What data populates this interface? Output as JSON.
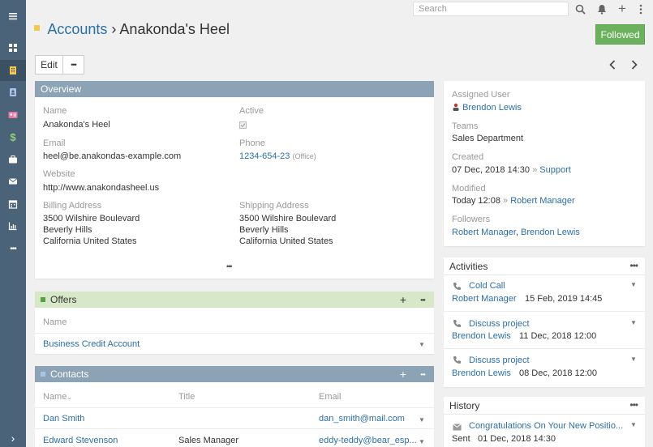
{
  "nav": {
    "items": [
      {
        "name": "menu-toggle",
        "icon": "hamburger-icon"
      },
      {
        "name": "home",
        "icon": "dashboard-icon"
      },
      {
        "name": "accounts",
        "icon": "building-icon",
        "active": true
      },
      {
        "name": "contacts",
        "icon": "contact-book-icon"
      },
      {
        "name": "leads",
        "icon": "id-card-icon"
      },
      {
        "name": "opportunities",
        "icon": "dollar-icon"
      },
      {
        "name": "cases",
        "icon": "briefcase-icon"
      },
      {
        "name": "emails",
        "icon": "envelope-icon"
      },
      {
        "name": "calendar",
        "icon": "calendar-icon"
      },
      {
        "name": "reports",
        "icon": "chart-icon"
      },
      {
        "name": "more",
        "icon": "more-icon"
      }
    ],
    "collapse": "chevron-right-icon"
  },
  "topbar": {
    "search_placeholder": "Search"
  },
  "header": {
    "scope": "Accounts",
    "separator": "›",
    "title": "Anakonda's Heel",
    "followed_label": "Followed"
  },
  "actions": {
    "edit_label": "Edit",
    "more_label": "•••"
  },
  "overview": {
    "title": "Overview",
    "name_label": "Name",
    "name_value": "Anakonda's Heel",
    "active_label": "Active",
    "email_label": "Email",
    "email_value": "heel@be.anakondas-example.com",
    "phone_label": "Phone",
    "phone_value": "1234-654-23",
    "phone_type": "(Office)",
    "website_label": "Website",
    "website_value": "http://www.anakondasheel.us",
    "billing_label": "Billing Address",
    "billing_street": "3500 Wilshire Boulevard",
    "billing_city": "Beverly Hills",
    "billing_state": "California United States",
    "shipping_label": "Shipping Address",
    "shipping_street": "3500 Wilshire Boulevard",
    "shipping_city": "Beverly Hills",
    "shipping_state": "California United States",
    "more": "•••"
  },
  "offers": {
    "title": "Offers",
    "column_name": "Name",
    "rows": [
      {
        "name": "Business Credit Account"
      }
    ]
  },
  "contacts": {
    "title": "Contacts",
    "columns": {
      "name": "Name",
      "title": "Title",
      "email": "Email"
    },
    "rows": [
      {
        "name": "Dan Smith",
        "title": "",
        "email": "dan_smith@mail.com"
      },
      {
        "name": "Edward Stevenson",
        "title": "Sales Manager",
        "email": "eddy-teddy@bear_esp..."
      }
    ]
  },
  "side": {
    "assigned_label": "Assigned User",
    "assigned_value": "Brendon Lewis",
    "teams_label": "Teams",
    "teams_value": "Sales Department",
    "created_label": "Created",
    "created_date": "07 Dec, 2018 14:30",
    "created_sep": "»",
    "created_by": "Support",
    "modified_label": "Modified",
    "modified_date": "Today 12:08",
    "modified_sep": "»",
    "modified_by": "Robert Manager",
    "followers_label": "Followers",
    "follower_1": "Robert Manager",
    "follower_sep": ",",
    "follower_2": "Brendon Lewis"
  },
  "activities": {
    "title": "Activities",
    "items": [
      {
        "subject": "Cold Call",
        "user": "Robert Manager",
        "date": "15 Feb, 2019 14:45"
      },
      {
        "subject": "Discuss project",
        "user": "Brendon Lewis",
        "date": "11 Dec, 2018 12:00"
      },
      {
        "subject": "Discuss project",
        "user": "Brendon Lewis",
        "date": "08 Dec, 2018 12:00"
      }
    ]
  },
  "history": {
    "title": "History",
    "items": [
      {
        "subject": "Congratulations On Your New Positio...",
        "status": "Sent",
        "date": "01 Dec, 2018 14:30"
      }
    ]
  },
  "colors": {
    "nav_bg": "#4a6378",
    "panel_header": "#8ba3b4",
    "offers_header": "#d6e8c7",
    "followed": "#6cb25d",
    "link": "#2c6fa8"
  }
}
